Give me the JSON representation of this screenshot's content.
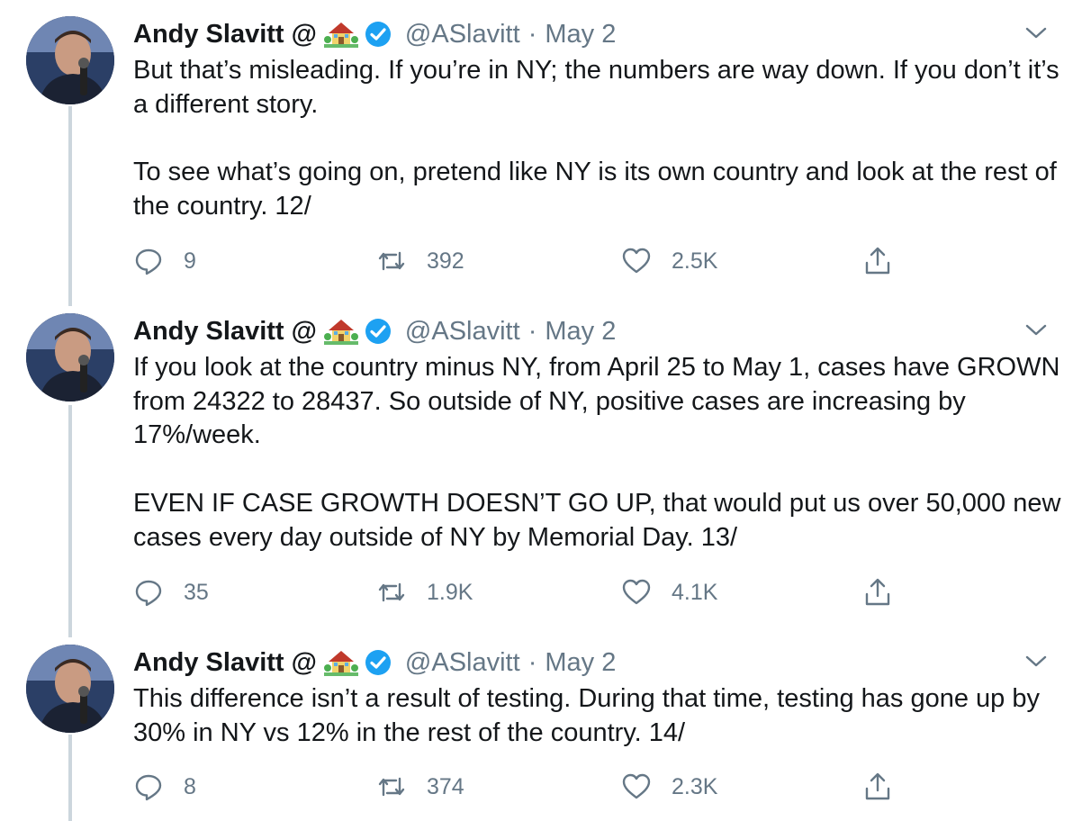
{
  "tweets": [
    {
      "author": {
        "name": "Andy Slavitt @",
        "handle": "@ASlavitt",
        "emoji_icon": "house-with-garden-icon",
        "verified": true
      },
      "separator": "·",
      "date": "May 2",
      "text": "But that’s misleading. If you’re in NY; the numbers are way down. If you don’t it’s a different story.\n\nTo see what’s going on, pretend like NY is its own country and look at the rest of the country. 12/",
      "stats": {
        "replies": "9",
        "retweets": "392",
        "likes": "2.5K"
      }
    },
    {
      "author": {
        "name": "Andy Slavitt @",
        "handle": "@ASlavitt",
        "emoji_icon": "house-with-garden-icon",
        "verified": true
      },
      "separator": "·",
      "date": "May 2",
      "text": "If you look at the country minus NY, from April 25 to May 1, cases have GROWN from 24322 to 28437. So outside of NY, positive cases are increasing by 17%/week.\n\nEVEN IF CASE GROWTH DOESN’T GO UP, that would put us over 50,000 new cases every day outside of NY by Memorial Day. 13/",
      "stats": {
        "replies": "35",
        "retweets": "1.9K",
        "likes": "4.1K"
      }
    },
    {
      "author": {
        "name": "Andy Slavitt @",
        "handle": "@ASlavitt",
        "emoji_icon": "house-with-garden-icon",
        "verified": true
      },
      "separator": "·",
      "date": "May 2",
      "text": "This difference isn’t a result of testing. During that time, testing has gone up by 30% in NY vs 12% in the rest of the country. 14/",
      "stats": {
        "replies": "8",
        "retweets": "374",
        "likes": "2.3K"
      }
    }
  ],
  "colors": {
    "text": "#14171a",
    "secondary": "#657786",
    "verified": "#1da1f2",
    "thread_line": "#ccd6dd"
  }
}
